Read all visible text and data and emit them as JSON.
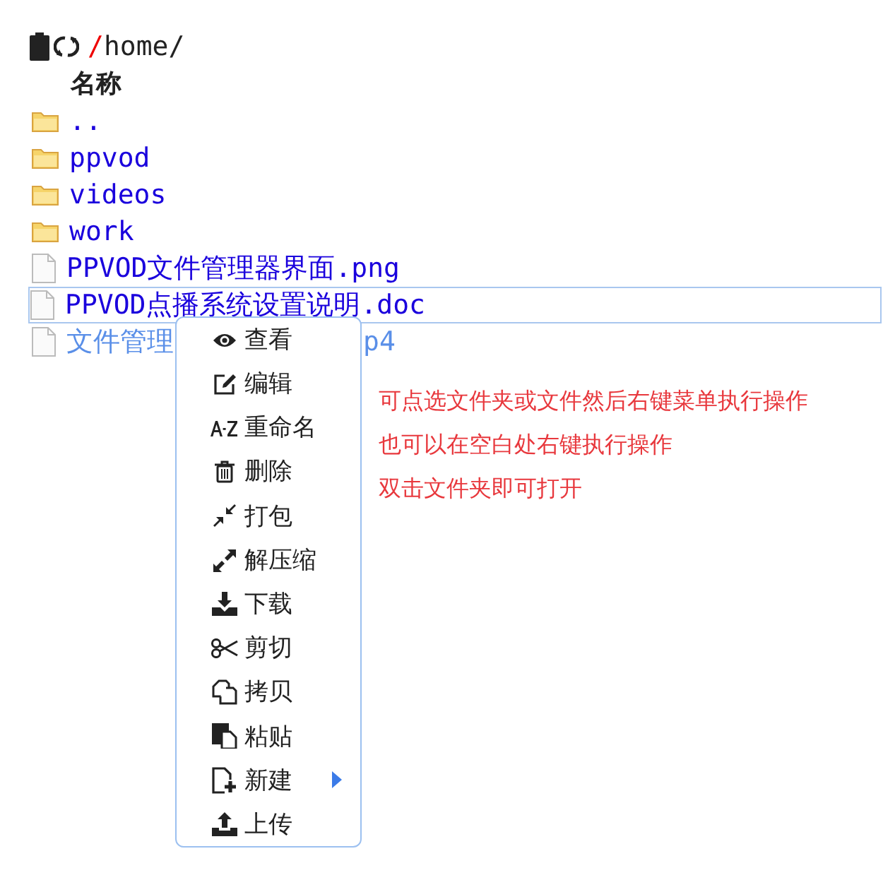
{
  "toolbar": {
    "path_prefix": "/",
    "path": "home/"
  },
  "table": {
    "columns": [
      "名称"
    ],
    "rows": [
      {
        "kind": "folder",
        "name": "..",
        "selected": false,
        "dimmed": false
      },
      {
        "kind": "folder",
        "name": "ppvod",
        "selected": false,
        "dimmed": false
      },
      {
        "kind": "folder",
        "name": "videos",
        "selected": false,
        "dimmed": false
      },
      {
        "kind": "folder",
        "name": "work",
        "selected": false,
        "dimmed": false
      },
      {
        "kind": "file",
        "name": "PPVOD文件管理器界面.png",
        "selected": false,
        "dimmed": false
      },
      {
        "kind": "file",
        "name": "PPVOD点播系统设置说明.doc",
        "selected": true,
        "dimmed": false
      },
      {
        "kind": "file",
        "name": "文件管理",
        "name_end": "p4",
        "selected": false,
        "dimmed": true
      }
    ]
  },
  "context_menu": {
    "items": [
      {
        "label": "查看",
        "submenu": false
      },
      {
        "label": "编辑",
        "submenu": false
      },
      {
        "label": "重命名",
        "submenu": false
      },
      {
        "label": "删除",
        "submenu": false
      },
      {
        "label": "打包",
        "submenu": false
      },
      {
        "label": "解压缩",
        "submenu": false
      },
      {
        "label": "下载",
        "submenu": false
      },
      {
        "label": "剪切",
        "submenu": false
      },
      {
        "label": "拷贝",
        "submenu": false
      },
      {
        "label": "粘贴",
        "submenu": false
      },
      {
        "label": "新建",
        "submenu": true
      },
      {
        "label": "上传",
        "submenu": false
      }
    ]
  },
  "notes": [
    "可点选文件夹或文件然后右键菜单执行操作",
    "也可以在空白处右键执行操作",
    "双击文件夹即可打开"
  ]
}
